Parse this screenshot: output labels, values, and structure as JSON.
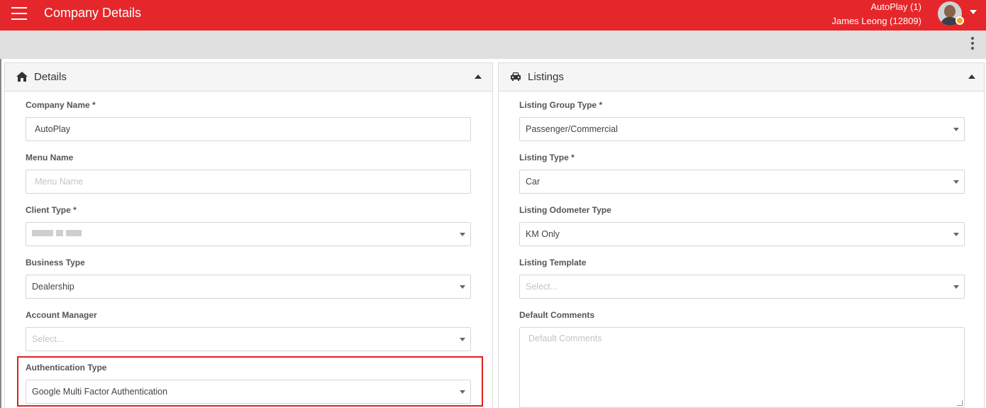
{
  "header": {
    "title": "Company Details",
    "company": "AutoPlay (1)",
    "user": "James Leong (12809)",
    "status_color": "#f5a623",
    "brand_color": "#e5272b"
  },
  "details": {
    "title": "Details",
    "icon": "home-icon",
    "company_name": {
      "label": "Company Name *",
      "value": "AutoPlay"
    },
    "menu_name": {
      "label": "Menu Name",
      "placeholder": "Menu Name"
    },
    "client_type": {
      "label": "Client Type *"
    },
    "business_type": {
      "label": "Business Type",
      "value": "Dealership"
    },
    "account_manager": {
      "label": "Account Manager",
      "placeholder": "Select..."
    },
    "authentication_type": {
      "label": "Authentication Type",
      "value": "Google Multi Factor Authentication"
    }
  },
  "listings": {
    "title": "Listings",
    "icon": "car-icon",
    "listing_group_type": {
      "label": "Listing Group Type *",
      "value": "Passenger/Commercial"
    },
    "listing_type": {
      "label": "Listing Type *",
      "value": "Car"
    },
    "listing_odometer_type": {
      "label": "Listing Odometer Type",
      "value": "KM Only"
    },
    "listing_template": {
      "label": "Listing Template",
      "placeholder": "Select..."
    },
    "default_comments": {
      "label": "Default Comments",
      "placeholder": "Default Comments"
    }
  }
}
